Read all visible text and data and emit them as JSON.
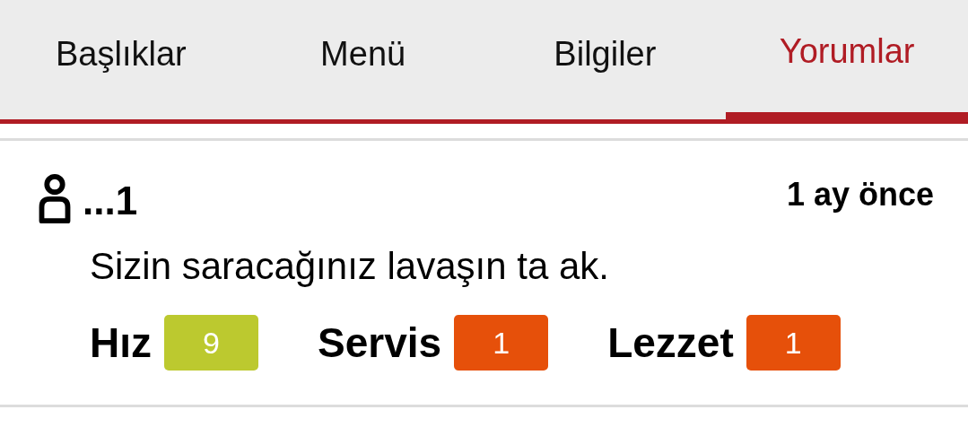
{
  "tabs": [
    {
      "label": "Başlıklar",
      "selected": false
    },
    {
      "label": "Menü",
      "selected": false
    },
    {
      "label": "Bilgiler",
      "selected": false
    },
    {
      "label": "Yorumlar",
      "selected": true
    }
  ],
  "review": {
    "user": "...1",
    "time": "1 ay önce",
    "text": "Sizin saracağınız lavaşın ta ak.",
    "ratings": [
      {
        "label": "Hız",
        "score": "9",
        "color": "#bcc92f"
      },
      {
        "label": "Servis",
        "score": "1",
        "color": "#e6500a"
      },
      {
        "label": "Lezzet",
        "score": "1",
        "color": "#e6500a"
      }
    ]
  }
}
